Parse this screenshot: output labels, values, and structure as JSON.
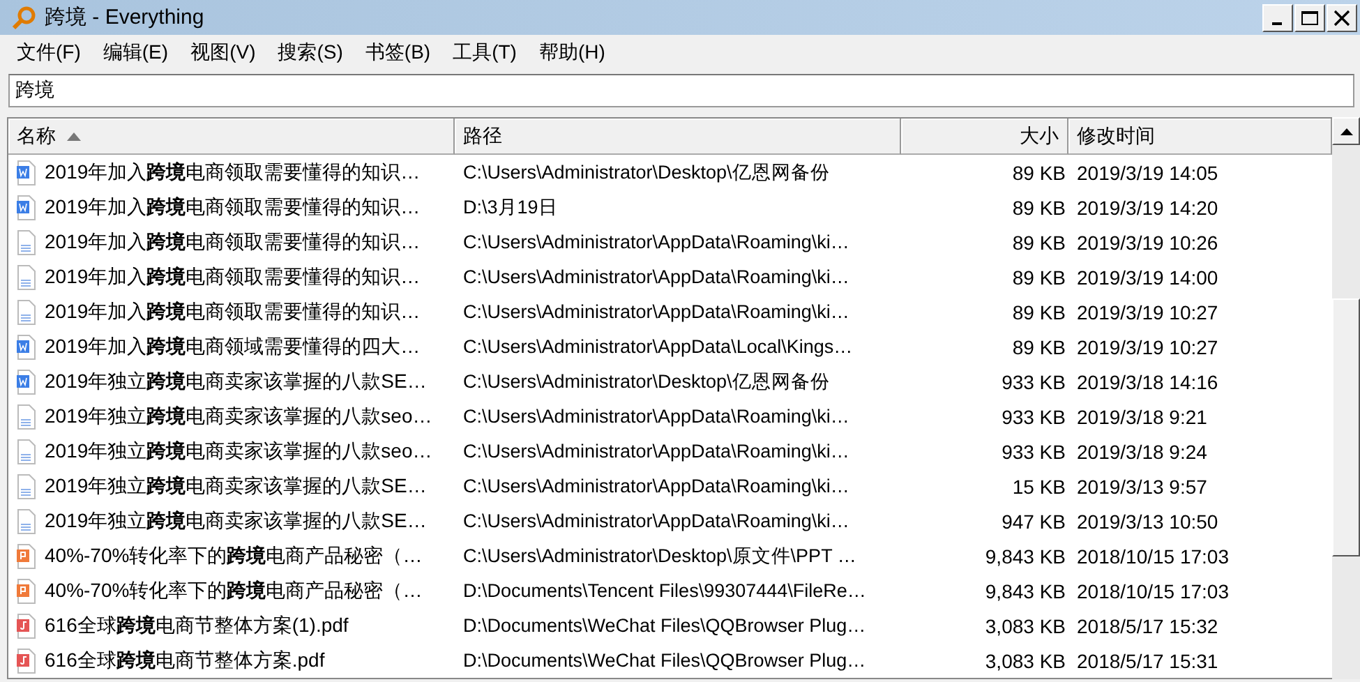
{
  "window": {
    "title": "跨境 - Everything"
  },
  "menu": [
    "文件(F)",
    "编辑(E)",
    "视图(V)",
    "搜索(S)",
    "书签(B)",
    "工具(T)",
    "帮助(H)"
  ],
  "search": {
    "value": "跨境"
  },
  "table": {
    "columns": [
      {
        "label": "名称",
        "sorted": true
      },
      {
        "label": "路径",
        "sorted": false
      },
      {
        "label": "大小",
        "sorted": false
      },
      {
        "label": "修改时间",
        "sorted": false
      }
    ],
    "rows": [
      {
        "kind": "word",
        "name": "2019年加入**跨境**电商领取需要懂得的知识…",
        "path": "C:\\Users\\Administrator\\Desktop\\亿恩网备份",
        "size": "89 KB",
        "modified": "2019/3/19 14:05"
      },
      {
        "kind": "word",
        "name": "2019年加入**跨境**电商领取需要懂得的知识…",
        "path": "D:\\3月19日",
        "size": "89 KB",
        "modified": "2019/3/19 14:20"
      },
      {
        "kind": "text",
        "name": "2019年加入**跨境**电商领取需要懂得的知识…",
        "path": "C:\\Users\\Administrator\\AppData\\Roaming\\ki…",
        "size": "89 KB",
        "modified": "2019/3/19 10:26"
      },
      {
        "kind": "text",
        "name": "2019年加入**跨境**电商领取需要懂得的知识…",
        "path": "C:\\Users\\Administrator\\AppData\\Roaming\\ki…",
        "size": "89 KB",
        "modified": "2019/3/19 14:00"
      },
      {
        "kind": "text",
        "name": "2019年加入**跨境**电商领取需要懂得的知识…",
        "path": "C:\\Users\\Administrator\\AppData\\Roaming\\ki…",
        "size": "89 KB",
        "modified": "2019/3/19 10:27"
      },
      {
        "kind": "word",
        "name": "2019年加入**跨境**电商领域需要懂得的四大…",
        "path": "C:\\Users\\Administrator\\AppData\\Local\\Kings…",
        "size": "89 KB",
        "modified": "2019/3/19 10:27"
      },
      {
        "kind": "word",
        "name": "2019年独立**跨境**电商卖家该掌握的八款SE…",
        "path": "C:\\Users\\Administrator\\Desktop\\亿恩网备份",
        "size": "933 KB",
        "modified": "2019/3/18 14:16"
      },
      {
        "kind": "text",
        "name": "2019年独立**跨境**电商卖家该掌握的八款seo…",
        "path": "C:\\Users\\Administrator\\AppData\\Roaming\\ki…",
        "size": "933 KB",
        "modified": "2019/3/18 9:21"
      },
      {
        "kind": "text",
        "name": "2019年独立**跨境**电商卖家该掌握的八款seo…",
        "path": "C:\\Users\\Administrator\\AppData\\Roaming\\ki…",
        "size": "933 KB",
        "modified": "2019/3/18 9:24"
      },
      {
        "kind": "text",
        "name": "2019年独立**跨境**电商卖家该掌握的八款SE…",
        "path": "C:\\Users\\Administrator\\AppData\\Roaming\\ki…",
        "size": "15 KB",
        "modified": "2019/3/13 9:57"
      },
      {
        "kind": "text",
        "name": "2019年独立**跨境**电商卖家该掌握的八款SE…",
        "path": "C:\\Users\\Administrator\\AppData\\Roaming\\ki…",
        "size": "947 KB",
        "modified": "2019/3/13 10:50"
      },
      {
        "kind": "ppt",
        "name": "40%-70%转化率下的**跨境**电商产品秘密（…",
        "path": "C:\\Users\\Administrator\\Desktop\\原文件\\PPT …",
        "size": "9,843 KB",
        "modified": "2018/10/15 17:03"
      },
      {
        "kind": "ppt",
        "name": "40%-70%转化率下的**跨境**电商产品秘密（…",
        "path": "D:\\Documents\\Tencent Files\\99307444\\FileRe…",
        "size": "9,843 KB",
        "modified": "2018/10/15 17:03"
      },
      {
        "kind": "pdf",
        "name": "616全球**跨境**电商节整体方案(1).pdf",
        "path": "D:\\Documents\\WeChat Files\\QQBrowser Plug…",
        "size": "3,083 KB",
        "modified": "2018/5/17 15:32"
      },
      {
        "kind": "pdf",
        "name": "616全球**跨境**电商节整体方案.pdf",
        "path": "D:\\Documents\\WeChat Files\\QQBrowser Plug…",
        "size": "3,083 KB",
        "modified": "2018/5/17 15:31"
      }
    ]
  }
}
